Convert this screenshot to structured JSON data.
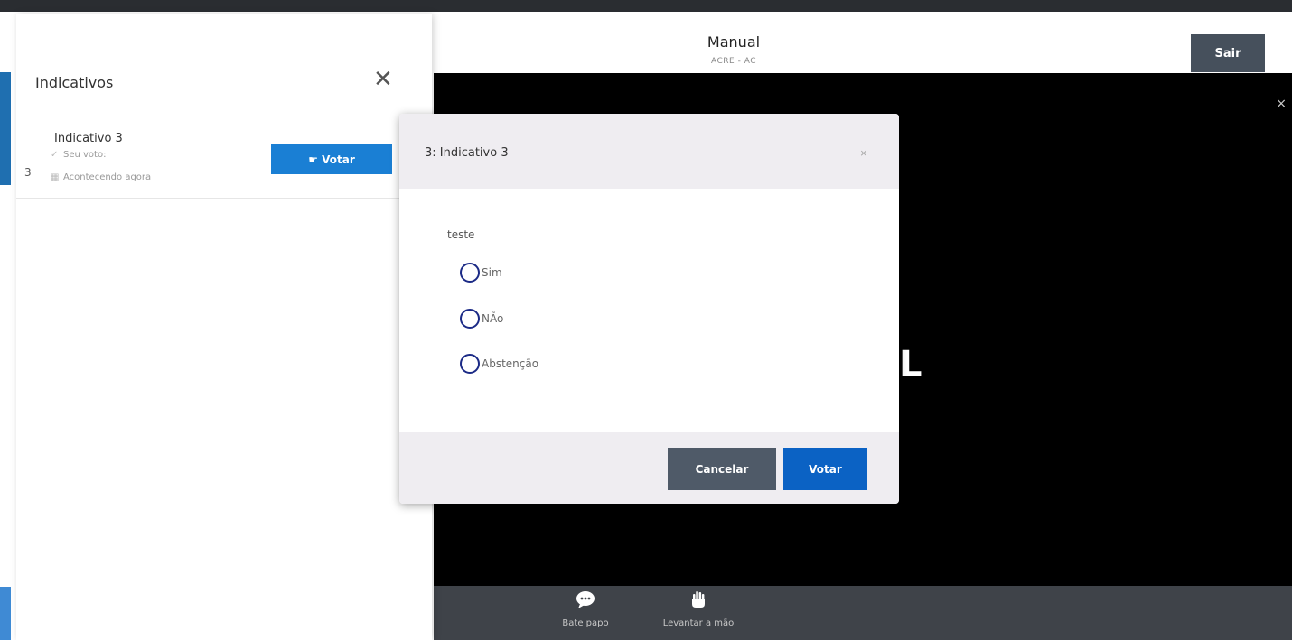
{
  "header": {
    "title": "Manual",
    "subtitle": "ACRE - AC",
    "exit_label": "Sair"
  },
  "video": {
    "overlay_letter": "L",
    "fullscreen_icon": "×"
  },
  "toolbar": {
    "chat_label": "Bate papo",
    "chat_icon": "chat-bubble-icon",
    "hand_label": "Levantar a mão",
    "hand_icon": "raise-hand-icon"
  },
  "sidebar": {
    "title": "Indicativos",
    "close_symbol": "✕",
    "items": [
      {
        "number": "3",
        "name": "Indicativo 3",
        "vote_label": "Seu voto:",
        "status": "Acontecendo agora",
        "button_label": "Votar"
      }
    ]
  },
  "modal": {
    "title": "3: Indicativo 3",
    "close_symbol": "×",
    "question": "teste",
    "options": [
      "Sim",
      "NÃo",
      "Abstenção"
    ],
    "cancel_label": "Cancelar",
    "submit_label": "Votar"
  },
  "colors": {
    "primary": "#1a7fd4",
    "submit": "#0b62c4",
    "cancel": "#4f5a68",
    "exit": "#46505c",
    "radio_border": "#1b2a86",
    "modal_header_bg": "#efedf1"
  }
}
